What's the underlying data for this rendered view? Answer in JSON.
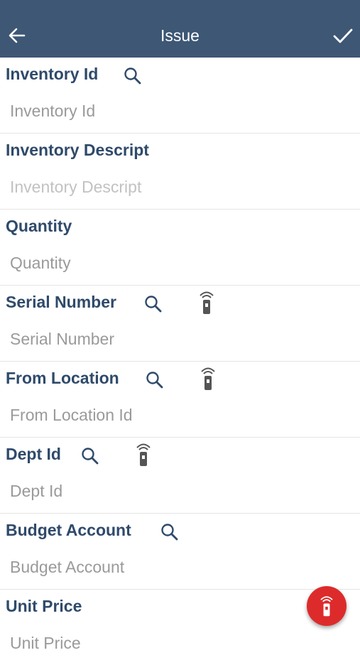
{
  "header": {
    "title": "Issue",
    "back_icon": "arrow-left-icon",
    "confirm_icon": "check-icon",
    "background": "#3d5775"
  },
  "fields": [
    {
      "label": "Inventory Id",
      "placeholder": "Inventory Id",
      "has_search": true,
      "has_scan": false,
      "editable": true
    },
    {
      "label": "Inventory Descript",
      "placeholder": "Inventory Descript",
      "has_search": false,
      "has_scan": false,
      "editable": false
    },
    {
      "label": "Quantity",
      "placeholder": "Quantity",
      "has_search": false,
      "has_scan": false,
      "editable": true
    },
    {
      "label": "Serial Number",
      "placeholder": "Serial Number",
      "has_search": true,
      "has_scan": true,
      "editable": true
    },
    {
      "label": "From Location",
      "placeholder": "From Location Id",
      "has_search": true,
      "has_scan": true,
      "editable": true
    },
    {
      "label": "Dept Id",
      "placeholder": "Dept Id",
      "has_search": true,
      "has_scan": true,
      "editable": true
    },
    {
      "label": "Budget Account",
      "placeholder": "Budget Account",
      "has_search": true,
      "has_scan": false,
      "editable": true
    },
    {
      "label": "Unit Price",
      "placeholder": "Unit Price",
      "has_search": false,
      "has_scan": false,
      "editable": true
    }
  ],
  "fab": {
    "icon": "scanner-icon",
    "color": "#dd2b2b"
  },
  "colors": {
    "label": "#2f4a6a",
    "placeholder": "#9a9a9a",
    "divider": "#e4e4e4"
  }
}
